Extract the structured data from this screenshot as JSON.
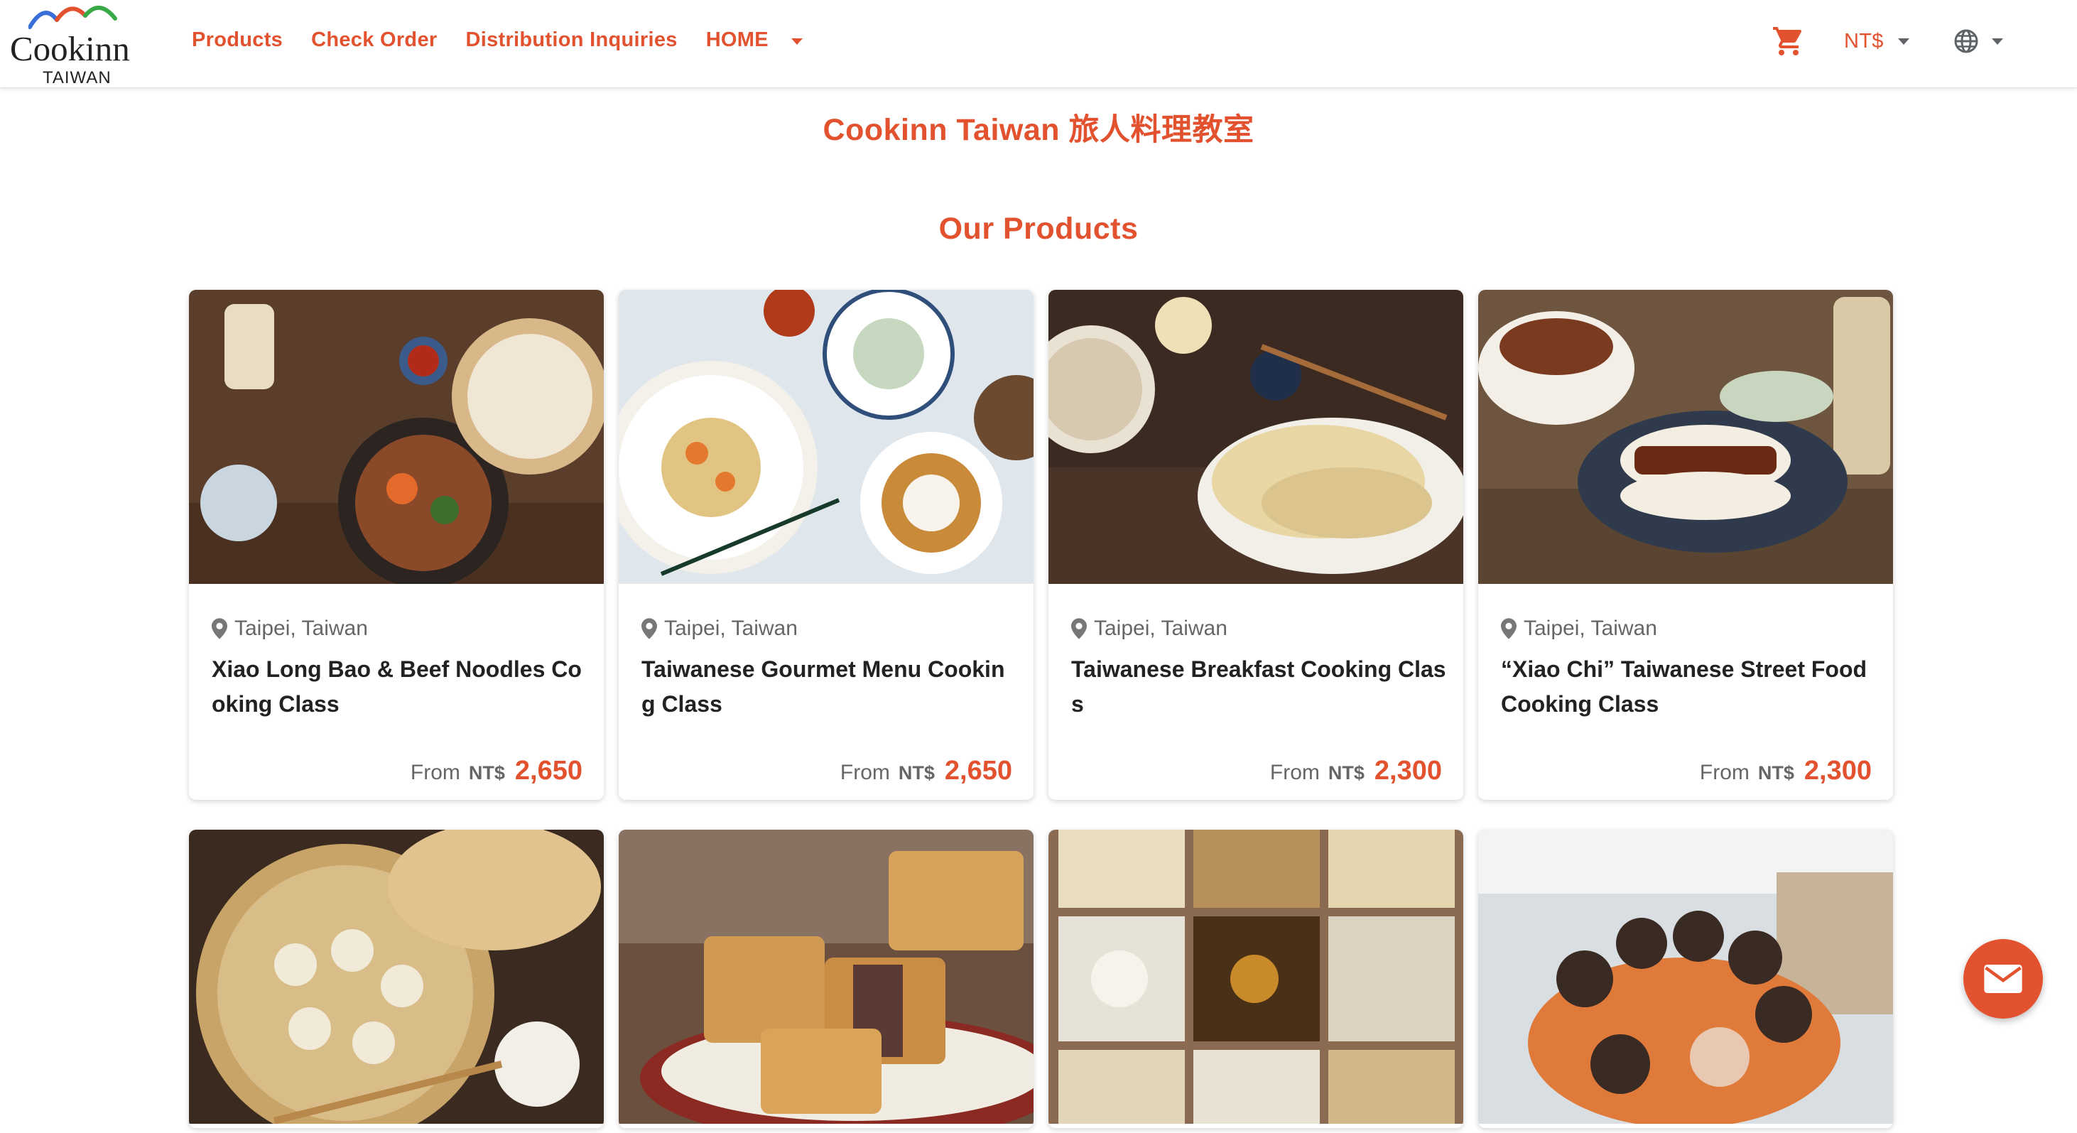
{
  "header": {
    "logo_text": "Cookinn",
    "logo_sub": "TAIWAN",
    "nav": [
      {
        "label": "Products"
      },
      {
        "label": "Check Order"
      },
      {
        "label": "Distribution Inquiries"
      },
      {
        "label": "HOME"
      }
    ],
    "currency": "NT$",
    "icons": [
      "cart-icon",
      "globe-icon",
      "chevron-down-icon"
    ]
  },
  "site_title": "Cookinn Taiwan 旅人料理教室",
  "section_title": "Our Products",
  "colors": {
    "accent": "#e2522f",
    "text_dark": "#222222",
    "text_muted": "#666666"
  },
  "products": [
    {
      "location": "Taipei, Taiwan",
      "name": "Xiao Long Bao & Beef Noodles Cooking Class",
      "from": "From",
      "currency": "NT$",
      "price": "2,650",
      "image": "xiao long bao and beef noodles"
    },
    {
      "location": "Taipei, Taiwan",
      "name": "Taiwanese Gourmet Menu Cooking Class",
      "from": "From",
      "currency": "NT$",
      "price": "2,650",
      "image": "taiwanese gourmet menu dishes"
    },
    {
      "location": "Taipei, Taiwan",
      "name": "Taiwanese Breakfast Cooking Class",
      "from": "From",
      "currency": "NT$",
      "price": "2,300",
      "image": "scallion pancakes and soy milk"
    },
    {
      "location": "Taipei, Taiwan",
      "name": "“Xiao Chi” Taiwanese Street Food Cooking Class",
      "from": "From",
      "currency": "NT$",
      "price": "2,300",
      "image": "gua bao and braised pork rice"
    },
    {
      "image": "steamer of xiao long bao"
    },
    {
      "image": "pineapple cakes"
    },
    {
      "image": "grid of taiwanese desserts"
    },
    {
      "image": "group of students in aprons"
    }
  ],
  "chat": {
    "icon": "mail-icon"
  }
}
